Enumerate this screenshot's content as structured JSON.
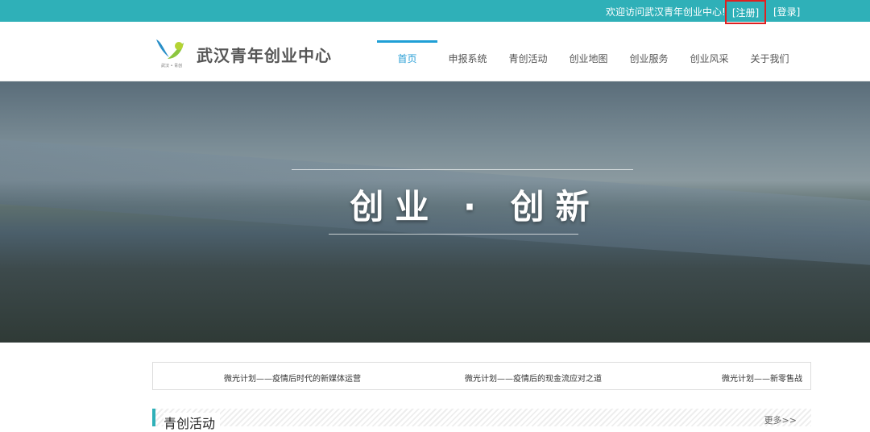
{
  "topbar": {
    "welcome": "欢迎访问武汉青年创业中心!",
    "register": "[注册]",
    "login": "[登录]"
  },
  "header": {
    "brand": "武汉青年创业中心",
    "logo_caption": "武汉 • 青创"
  },
  "nav": [
    {
      "label": "首页",
      "active": true
    },
    {
      "label": "申报系统"
    },
    {
      "label": "青创活动"
    },
    {
      "label": "创业地图"
    },
    {
      "label": "创业服务"
    },
    {
      "label": "创业风采"
    },
    {
      "label": "关于我们"
    }
  ],
  "hero": {
    "slogan": "创业 · 创新"
  },
  "news": [
    "微光计划——疫情后时代的新媒体运营",
    "微光计划——疫情后的现金流应对之道",
    "微光计划——新零售战"
  ],
  "section": {
    "title": "青创活动",
    "more": "更多>>"
  },
  "colors": {
    "accent": "#2fb0b8",
    "nav_active": "#1f9fd6"
  }
}
